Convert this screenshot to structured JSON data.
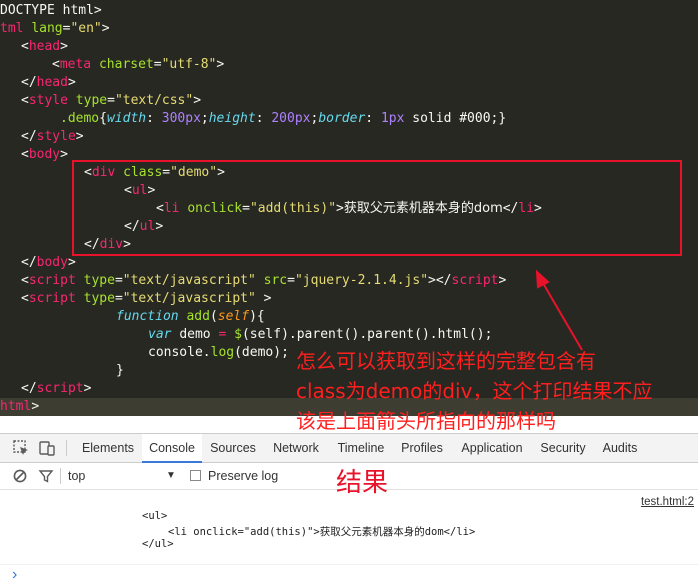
{
  "editor": {
    "lines": {
      "l1": "DOCTYPE html>",
      "l2_tag": "tml",
      "l2_attr": "lang",
      "l2_val": "\"en\"",
      "l3": "head",
      "l4_tag": "meta",
      "l4_attr": "charset",
      "l4_val": "\"utf-8\"",
      "l5": "head",
      "l6_tag": "style",
      "l6_attr": "type",
      "l6_val": "\"text/css\"",
      "l7_sel": ".demo",
      "l7_p1": "width",
      "l7_v1": "300px",
      "l7_p2": "height",
      "l7_v2": "200px",
      "l7_p3": "border",
      "l7_v3": "1px",
      "l7_rest": "solid #000",
      "l8": "style",
      "l9": "body",
      "l10_tag": "div",
      "l10_attr": "class",
      "l10_val": "\"demo\"",
      "l11": "ul",
      "l12_tag": "li",
      "l12_attr": "onclick",
      "l12_val": "\"add(this)\"",
      "l12_text": "获取父元素机器本身的dom",
      "l12_close": "li",
      "l13": "ul",
      "l14": "div",
      "l15": "body",
      "l16_tag": "script",
      "l16_attr1": "type",
      "l16_val1": "\"text/javascript\"",
      "l16_attr2": "src",
      "l16_val2": "\"jquery-2.1.4.js\"",
      "l16_close": "script",
      "l17_tag": "script",
      "l17_attr": "type",
      "l17_val": "\"text/javascript\"",
      "l18_kw": "function",
      "l18_fn": "add",
      "l18_arg": "self",
      "l19_kw": "var",
      "l19_code": "demo",
      "l19_dollar": "$",
      "l19_rest": "(self).parent().parent().html();",
      "l20_obj": "console",
      "l20_fn": "log",
      "l20_rest": "(demo);",
      "l21": "}",
      "l22": "script",
      "l23": "html"
    }
  },
  "annotation": {
    "line1": "怎么可以获取到这样的完整包含有",
    "line2": "class为demo的div，这个打印结果不应",
    "line3": "该是上面箭头所指向的那样吗"
  },
  "devtools": {
    "tabs": [
      "Elements",
      "Console",
      "Sources",
      "Network",
      "Timeline",
      "Profiles",
      "Application",
      "Security",
      "Audits"
    ],
    "active_tab": "Console",
    "context": "top",
    "preserve_log": "Preserve log",
    "source_link": "test.html:2",
    "output": {
      "o1": "<ul>",
      "o2": "<li onclick=\"add(this)\">获取父元素机器本身的dom</li>",
      "o3": "</ul>"
    },
    "prompt": "›"
  },
  "result_label": "结果",
  "colors": {
    "annotation": "#ff1f1f",
    "box": "#e8132b",
    "editor_bg": "#272822",
    "tab_accent": "#3879d9"
  }
}
